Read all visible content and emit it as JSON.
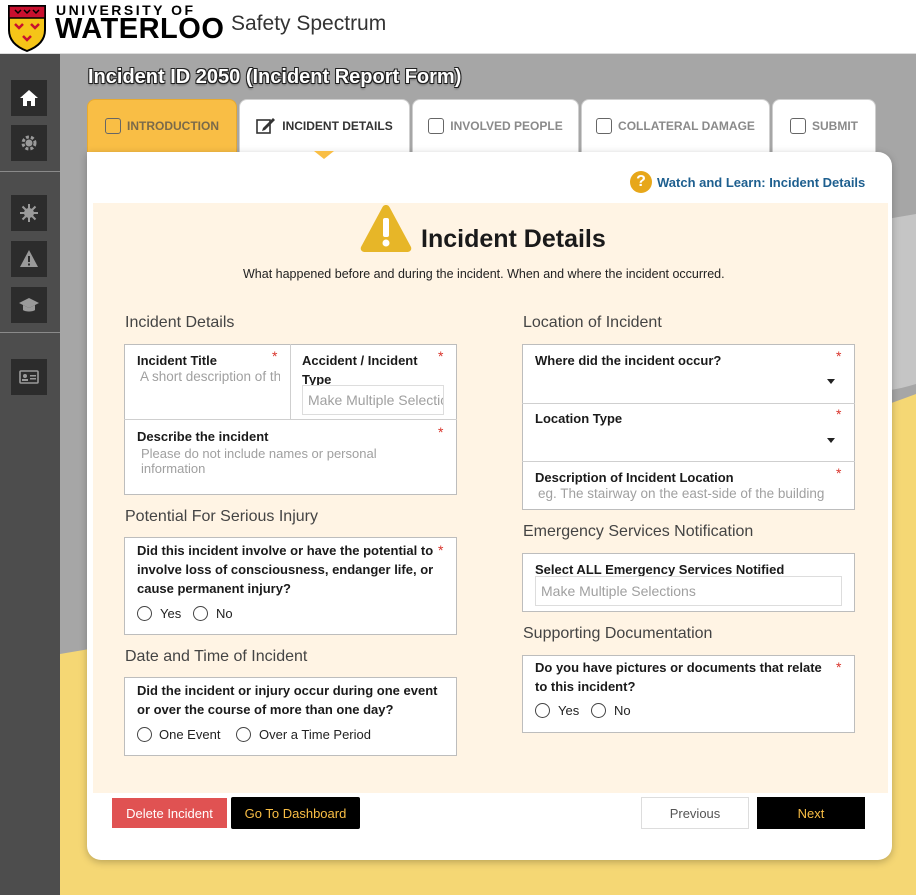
{
  "brand": {
    "line1": "UNIVERSITY OF",
    "line2": "WATERLOO",
    "app_title": "Safety Spectrum"
  },
  "sidebar": {
    "items": [
      {
        "name": "home-icon"
      },
      {
        "name": "gear-icon"
      },
      {
        "name": "virus-icon"
      },
      {
        "name": "warning-icon"
      },
      {
        "name": "graduation-cap-icon"
      },
      {
        "name": "id-card-icon"
      }
    ]
  },
  "page_title": "Incident ID 2050 (Incident Report Form)",
  "tabs": [
    {
      "label": "INTRODUCTION"
    },
    {
      "label": "INCIDENT DETAILS"
    },
    {
      "label": "INVOLVED PEOPLE"
    },
    {
      "label": "COLLATERAL DAMAGE"
    },
    {
      "label": "SUBMIT"
    }
  ],
  "watch_link": "Watch and Learn: Incident Details",
  "header": {
    "title": "Incident Details",
    "subtitle": "What happened before and during the incident. When and where the incident occurred."
  },
  "left": {
    "incident_details": {
      "title": "Incident Details",
      "incident_title_label": "Incident Title",
      "incident_title_placeholder": "A short description of th",
      "type_label": "Accident / Incident Type",
      "type_placeholder": "Make Multiple Selectio",
      "describe_label": "Describe the incident",
      "describe_placeholder": "Please do not include names or personal information"
    },
    "serious_injury": {
      "title": "Potential For Serious Injury",
      "question": "Did this incident involve or have the potential to involve loss of consciousness, endanger life, or cause permanent injury?",
      "options": [
        "Yes",
        "No"
      ]
    },
    "date_time": {
      "title": "Date and Time of Incident",
      "question": "Did the incident or injury occur during one event or over the course of more than one day?",
      "options": [
        "One Event",
        "Over a Time Period"
      ]
    }
  },
  "right": {
    "location": {
      "title": "Location of Incident",
      "where_label": "Where did the incident occur?",
      "type_label": "Location Type",
      "desc_label": "Description of Incident Location",
      "desc_placeholder": "eg. The stairway on the east-side of the building"
    },
    "emergency": {
      "title": "Emergency Services Notification",
      "label": "Select ALL Emergency Services Notified",
      "placeholder": "Make Multiple Selections"
    },
    "documentation": {
      "title": "Supporting Documentation",
      "question": "Do you have pictures or documents that relate to this incident?",
      "options": [
        "Yes",
        "No"
      ]
    }
  },
  "buttons": {
    "delete": "Delete Incident",
    "dashboard": "Go To Dashboard",
    "previous": "Previous",
    "next": "Next"
  },
  "required_mark": "*",
  "colors": {
    "accent": "#f9be45",
    "danger": "#e05252",
    "link": "#1e5f8f",
    "sidebar": "#4d4d4d"
  }
}
